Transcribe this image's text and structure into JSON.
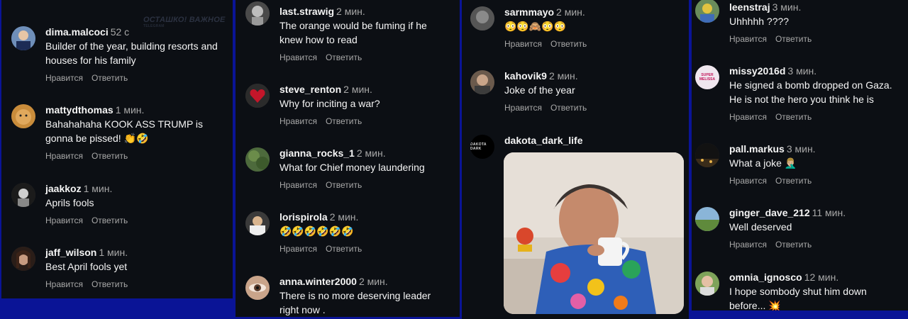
{
  "watermark": {
    "text": "ОСТАШКО! ВАЖНОЕ",
    "sub": "TELEGRAM"
  },
  "actions": {
    "like": "Нравится",
    "reply": "Ответить"
  },
  "panels": [
    {
      "comments": [
        {
          "username": "dima.malcoci",
          "time": "52 с",
          "text": "Builder of the year, building resorts and houses for his family"
        },
        {
          "username": "mattydthomas",
          "time": "1 мин.",
          "text": "Bahahahaha KOOK ASS TRUMP is gonna be pissed! 👏🤣"
        },
        {
          "username": "jaakkoz",
          "time": "1 мин.",
          "text": "Aprils fools"
        },
        {
          "username": "jaff_wilson",
          "time": "1 мин.",
          "text": "Best April fools yet"
        }
      ]
    },
    {
      "comments": [
        {
          "username": "last.strawig",
          "time": "2 мин.",
          "text": "The orange would be fuming if he knew how to read"
        },
        {
          "username": "steve_renton",
          "time": "2 мин.",
          "text": "Why for inciting a war?"
        },
        {
          "username": "gianna_rocks_1",
          "time": "2 мин.",
          "text": "What for Chief money laundering"
        },
        {
          "username": "lorispirola",
          "time": "2 мин.",
          "text": "🤣🤣🤣🤣🤣🤣"
        },
        {
          "username": "anna.winter2000",
          "time": "2 мин.",
          "text": "There is no more deserving leader right now ."
        }
      ]
    },
    {
      "comments": [
        {
          "username": "sarmmayo",
          "time": "2 мин.",
          "text": "😳😳🙈😳😳"
        },
        {
          "username": "kahovik9",
          "time": "2 мин.",
          "text": "Joke of the year"
        },
        {
          "username": "dakota_dark_life",
          "time": "",
          "text": ""
        }
      ]
    },
    {
      "comments": [
        {
          "username": "leenstraj",
          "time": "3 мин.",
          "text": "Uhhhhh ????"
        },
        {
          "username": "missy2016d",
          "time": "3 мин.",
          "text": "He signed a bomb dropped on Gaza. He is not the hero you think he is"
        },
        {
          "username": "pall.markus",
          "time": "3 мин.",
          "text": "What a joke 🤦🏼‍♂️"
        },
        {
          "username": "ginger_dave_212",
          "time": "11 мин.",
          "text": "Well deserved"
        },
        {
          "username": "omnia_ignosco",
          "time": "12 мин.",
          "text": "I hope sombody shut him down before... 💥"
        }
      ]
    }
  ],
  "avatars": {
    "dakota_logo": "DAKOTA DARK",
    "missy_badge": "SUPER MELISSA"
  },
  "colors": {
    "panel_bg": "#0c0f14",
    "page_bg": "#0a1496",
    "muted": "#a8a8a8",
    "text": "#f5f5f5"
  }
}
